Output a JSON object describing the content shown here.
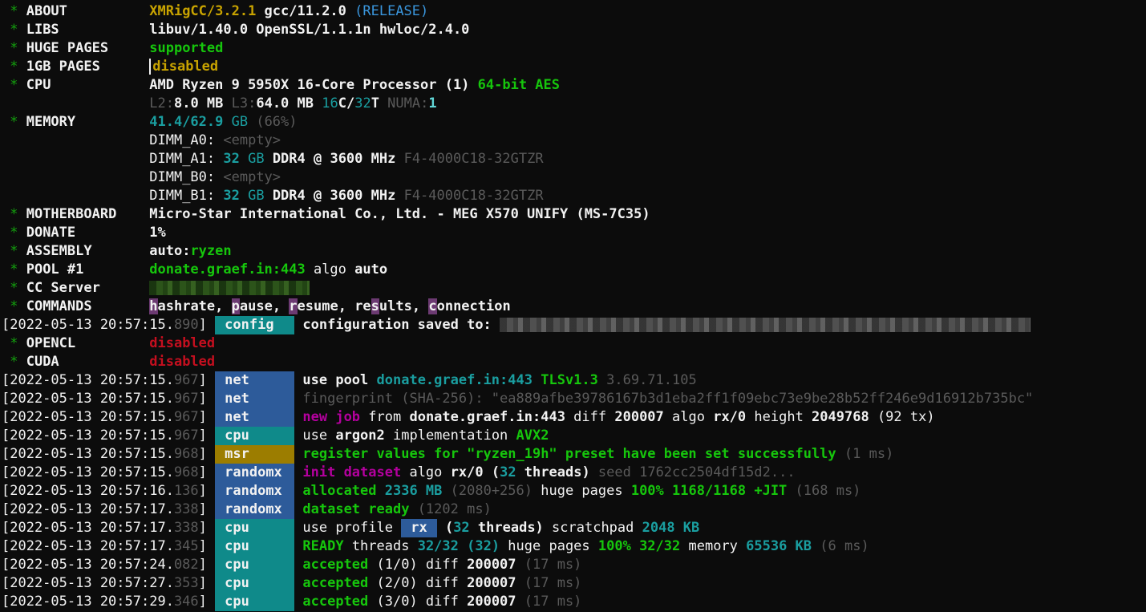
{
  "header": [
    {
      "key": "ABOUT",
      "parts": [
        {
          "t": "XMRigCC/3.2.1",
          "c": "yb"
        },
        {
          "t": " gcc/11.2.0 ",
          "c": "w b"
        },
        {
          "t": "(RELEASE)",
          "c": "c"
        }
      ]
    },
    {
      "key": "LIBS",
      "parts": [
        {
          "t": "libuv/1.40.0 OpenSSL/1.1.1n hwloc/2.4.0",
          "c": "w b"
        }
      ]
    },
    {
      "key": "HUGE PAGES",
      "parts": [
        {
          "t": "supported",
          "c": "gb"
        }
      ]
    },
    {
      "key": "1GB PAGES",
      "cursor": true,
      "parts": [
        {
          "t": "disabled",
          "c": "yb"
        }
      ]
    },
    {
      "key": "CPU",
      "parts": [
        {
          "t": "AMD Ryzen 9 5950X 16-Core Processor (1) ",
          "c": "w b"
        },
        {
          "t": "64-bit AES",
          "c": "gb"
        }
      ]
    },
    {
      "key": "",
      "parts": [
        {
          "t": "L2:",
          "c": "gray"
        },
        {
          "t": "8.0 MB ",
          "c": "w b"
        },
        {
          "t": "L3:",
          "c": "gray"
        },
        {
          "t": "64.0 MB ",
          "c": "w b"
        },
        {
          "t": "16",
          "c": "cyan"
        },
        {
          "t": "C/",
          "c": "w b"
        },
        {
          "t": "32",
          "c": "cyan"
        },
        {
          "t": "T ",
          "c": "w b"
        },
        {
          "t": "NUMA:",
          "c": "gray"
        },
        {
          "t": "1",
          "c": "cb"
        }
      ]
    },
    {
      "key": "MEMORY",
      "parts": [
        {
          "t": "41.4/62.9",
          "c": "cyan b"
        },
        {
          "t": " GB ",
          "c": "cyan"
        },
        {
          "t": "(66%)",
          "c": "gray"
        }
      ]
    },
    {
      "key": "",
      "parts": [
        {
          "t": "DIMM_A0: ",
          "c": "w"
        },
        {
          "t": "<empty>",
          "c": "gray"
        }
      ]
    },
    {
      "key": "",
      "parts": [
        {
          "t": "DIMM_A1: ",
          "c": "w"
        },
        {
          "t": "32",
          "c": "cyan b"
        },
        {
          "t": " GB ",
          "c": "cyan"
        },
        {
          "t": "DDR4 @ 3600 MHz ",
          "c": "w b"
        },
        {
          "t": "F4-4000C18-32GTZR",
          "c": "gray"
        }
      ]
    },
    {
      "key": "",
      "parts": [
        {
          "t": "DIMM_B0: ",
          "c": "w"
        },
        {
          "t": "<empty>",
          "c": "gray"
        }
      ]
    },
    {
      "key": "",
      "parts": [
        {
          "t": "DIMM_B1: ",
          "c": "w"
        },
        {
          "t": "32",
          "c": "cyan b"
        },
        {
          "t": " GB ",
          "c": "cyan"
        },
        {
          "t": "DDR4 @ 3600 MHz ",
          "c": "w b"
        },
        {
          "t": "F4-4000C18-32GTZR",
          "c": "gray"
        }
      ]
    },
    {
      "key": "MOTHERBOARD",
      "parts": [
        {
          "t": "Micro-Star International Co., Ltd. - MEG X570 UNIFY (MS-7C35)",
          "c": "w b"
        }
      ]
    },
    {
      "key": "DONATE",
      "parts": [
        {
          "t": "1%",
          "c": "w b"
        }
      ]
    },
    {
      "key": "ASSEMBLY",
      "parts": [
        {
          "t": "auto:",
          "c": "w b"
        },
        {
          "t": "ryzen",
          "c": "gb"
        }
      ]
    },
    {
      "key": "POOL #1",
      "parts": [
        {
          "t": "donate.graef.in:443",
          "c": "gb"
        },
        {
          "t": " algo ",
          "c": "w"
        },
        {
          "t": "auto",
          "c": "w b"
        }
      ]
    },
    {
      "key": "CC Server",
      "blur": {
        "w": 200,
        "green": true
      },
      "parts": []
    },
    {
      "key": "COMMANDS",
      "parts": [
        {
          "t": "h",
          "c": "w b hl-mag"
        },
        {
          "t": "ashrate, ",
          "c": "w b"
        },
        {
          "t": "p",
          "c": "w b hl-mag"
        },
        {
          "t": "ause, ",
          "c": "w b"
        },
        {
          "t": "r",
          "c": "w b hl-mag"
        },
        {
          "t": "esume, re",
          "c": "w b"
        },
        {
          "t": "s",
          "c": "w b hl-mag"
        },
        {
          "t": "ults, ",
          "c": "w b"
        },
        {
          "t": "c",
          "c": "w b hl-mag"
        },
        {
          "t": "onnection",
          "c": "w b"
        }
      ]
    }
  ],
  "log_config": {
    "ts": "[2022-05-13 20:57:15.",
    "ms": "890",
    "tag": "config",
    "tagColor": "teal",
    "parts": [
      {
        "t": "configuration saved to: ",
        "c": "w b"
      }
    ],
    "blur": {
      "w": 662,
      "green": false
    }
  },
  "after_config": [
    {
      "key": "OPENCL",
      "parts": [
        {
          "t": "disabled",
          "c": "r"
        }
      ]
    },
    {
      "key": "CUDA",
      "parts": [
        {
          "t": "disabled",
          "c": "r"
        }
      ]
    }
  ],
  "log": [
    {
      "ts": "[2022-05-13 20:57:15.",
      "ms": "967",
      "tag": "net",
      "tagColor": "blue",
      "parts": [
        {
          "t": "use pool ",
          "c": "w b"
        },
        {
          "t": "donate.graef.in:443",
          "c": "cyan b"
        },
        {
          "t": " ",
          "c": "w"
        },
        {
          "t": "TLSv1.3",
          "c": "gb"
        },
        {
          "t": " 3.69.71.105",
          "c": "gray"
        }
      ]
    },
    {
      "ts": "[2022-05-13 20:57:15.",
      "ms": "967",
      "tag": "net",
      "tagColor": "blue",
      "parts": [
        {
          "t": "fingerprint (SHA-256): \"ea889afbe39786167b3d1eba2ff1f09ebc73e9be28b52ff246e9d16912b735bc\"",
          "c": "gray"
        }
      ]
    },
    {
      "ts": "[2022-05-13 20:57:15.",
      "ms": "967",
      "tag": "net",
      "tagColor": "blue",
      "parts": [
        {
          "t": "new job",
          "c": "mb"
        },
        {
          "t": " from ",
          "c": "w"
        },
        {
          "t": "donate.graef.in:443",
          "c": "w b"
        },
        {
          "t": " diff ",
          "c": "w"
        },
        {
          "t": "200007",
          "c": "w b"
        },
        {
          "t": " algo ",
          "c": "w"
        },
        {
          "t": "rx/0",
          "c": "w b"
        },
        {
          "t": " height ",
          "c": "w"
        },
        {
          "t": "2049768",
          "c": "w b"
        },
        {
          "t": " (92 tx)",
          "c": "w"
        }
      ]
    },
    {
      "ts": "[2022-05-13 20:57:15.",
      "ms": "967",
      "tag": "cpu",
      "tagColor": "teal",
      "parts": [
        {
          "t": "use ",
          "c": "w"
        },
        {
          "t": "argon2",
          "c": "w b"
        },
        {
          "t": " implementation ",
          "c": "w"
        },
        {
          "t": "AVX2",
          "c": "gb"
        }
      ]
    },
    {
      "ts": "[2022-05-13 20:57:15.",
      "ms": "968",
      "tag": "msr",
      "tagColor": "ochre",
      "parts": [
        {
          "t": "register values for \"ryzen_19h\" preset have been set successfully",
          "c": "gb"
        },
        {
          "t": " (1 ms)",
          "c": "gray"
        }
      ]
    },
    {
      "ts": "[2022-05-13 20:57:15.",
      "ms": "968",
      "tag": "randomx",
      "tagColor": "blue",
      "parts": [
        {
          "t": "init dataset",
          "c": "mb"
        },
        {
          "t": " algo ",
          "c": "w"
        },
        {
          "t": "rx/0",
          "c": "w b"
        },
        {
          "t": " (",
          "c": "w b"
        },
        {
          "t": "32",
          "c": "cyan b"
        },
        {
          "t": " threads)",
          "c": "w b"
        },
        {
          "t": " seed 1762cc2504df15d2...",
          "c": "gray"
        }
      ]
    },
    {
      "ts": "[2022-05-13 20:57:16.",
      "ms": "136",
      "tag": "randomx",
      "tagColor": "blue",
      "parts": [
        {
          "t": "allocated ",
          "c": "gb"
        },
        {
          "t": "2336 MB",
          "c": "cyan b"
        },
        {
          "t": " (2080+256)",
          "c": "gray"
        },
        {
          "t": " huge pages ",
          "c": "w"
        },
        {
          "t": "100% 1168/1168 +JIT",
          "c": "gb"
        },
        {
          "t": " (168 ms)",
          "c": "gray"
        }
      ]
    },
    {
      "ts": "[2022-05-13 20:57:17.",
      "ms": "338",
      "tag": "randomx",
      "tagColor": "blue",
      "parts": [
        {
          "t": "dataset ready",
          "c": "gb"
        },
        {
          "t": " (1202 ms)",
          "c": "gray"
        }
      ]
    },
    {
      "ts": "[2022-05-13 20:57:17.",
      "ms": "338",
      "tag": "cpu",
      "tagColor": "teal",
      "rx": "rx",
      "parts": [
        {
          "t": "use profile ",
          "c": "w"
        }
      ],
      "parts2": [
        {
          "t": " (",
          "c": "w b"
        },
        {
          "t": "32",
          "c": "cyan b"
        },
        {
          "t": " threads)",
          "c": "w b"
        },
        {
          "t": " scratchpad ",
          "c": "w"
        },
        {
          "t": "2048 KB",
          "c": "cyan b"
        }
      ]
    },
    {
      "ts": "[2022-05-13 20:57:17.",
      "ms": "345",
      "tag": "cpu",
      "tagColor": "teal",
      "parts": [
        {
          "t": "READY",
          "c": "gb"
        },
        {
          "t": " threads ",
          "c": "w"
        },
        {
          "t": "32/32 (32)",
          "c": "cyan b"
        },
        {
          "t": " huge pages ",
          "c": "w"
        },
        {
          "t": "100% 32/32",
          "c": "gb"
        },
        {
          "t": " memory ",
          "c": "w"
        },
        {
          "t": "65536 KB",
          "c": "cyan b"
        },
        {
          "t": " (6 ms)",
          "c": "gray"
        }
      ]
    },
    {
      "ts": "[2022-05-13 20:57:24.",
      "ms": "082",
      "tag": "cpu",
      "tagColor": "teal",
      "parts": [
        {
          "t": "accepted",
          "c": "gb"
        },
        {
          "t": " (1/0) diff ",
          "c": "w"
        },
        {
          "t": "200007",
          "c": "w b"
        },
        {
          "t": " (17 ms)",
          "c": "gray"
        }
      ]
    },
    {
      "ts": "[2022-05-13 20:57:27.",
      "ms": "353",
      "tag": "cpu",
      "tagColor": "teal",
      "parts": [
        {
          "t": "accepted",
          "c": "gb"
        },
        {
          "t": " (2/0) diff ",
          "c": "w"
        },
        {
          "t": "200007",
          "c": "w b"
        },
        {
          "t": " (17 ms)",
          "c": "gray"
        }
      ]
    },
    {
      "ts": "[2022-05-13 20:57:29.",
      "ms": "346",
      "tag": "cpu",
      "tagColor": "teal",
      "parts": [
        {
          "t": "accepted",
          "c": "gb"
        },
        {
          "t": " (3/0) diff ",
          "c": "w"
        },
        {
          "t": "200007",
          "c": "w b"
        },
        {
          "t": " (17 ms)",
          "c": "gray"
        }
      ]
    }
  ]
}
